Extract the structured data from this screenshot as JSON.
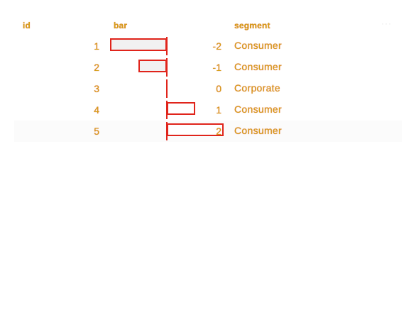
{
  "table": {
    "columns": {
      "id": "id",
      "bar": "bar",
      "segment": "segment"
    },
    "menu_label": "···",
    "accent_color": "#e0241b",
    "text_color": "#d4a017",
    "rows": [
      {
        "id": "1",
        "value": -2,
        "value_label": "-2",
        "segment": "Consumer"
      },
      {
        "id": "2",
        "value": -1,
        "value_label": "-1",
        "segment": "Consumer"
      },
      {
        "id": "3",
        "value": 0,
        "value_label": "0",
        "segment": "Corporate"
      },
      {
        "id": "4",
        "value": 1,
        "value_label": "1",
        "segment": "Consumer"
      },
      {
        "id": "5",
        "value": 2,
        "value_label": "2",
        "segment": "Consumer"
      }
    ]
  }
}
